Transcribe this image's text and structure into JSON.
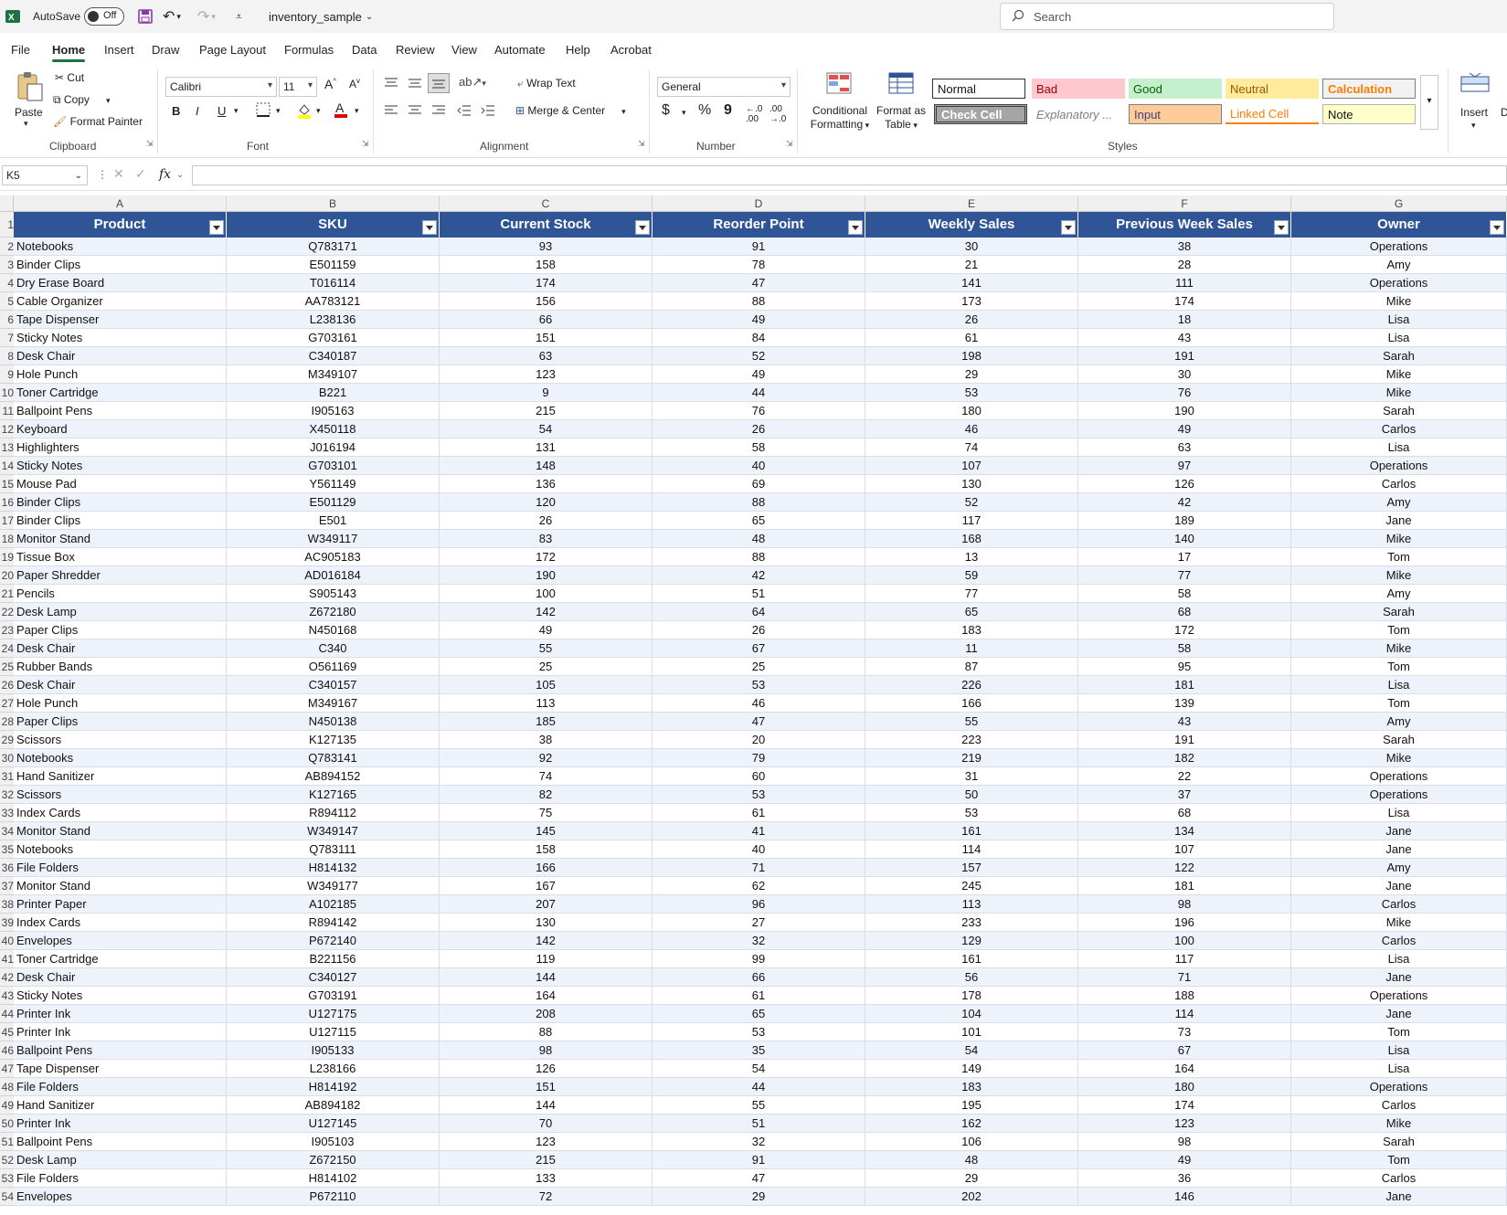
{
  "titlebar": {
    "autosave_label": "AutoSave",
    "autosave_state": "Off",
    "filename": "inventory_sample",
    "search_placeholder": "Search"
  },
  "menu": [
    "File",
    "Home",
    "Insert",
    "Draw",
    "Page Layout",
    "Formulas",
    "Data",
    "Review",
    "View",
    "Automate",
    "Help",
    "Acrobat"
  ],
  "ribbon": {
    "clipboard": {
      "paste": "Paste",
      "cut": "Cut",
      "copy": "Copy",
      "format_painter": "Format Painter",
      "label": "Clipboard"
    },
    "font": {
      "name": "Calibri",
      "size": "11",
      "bold": "B",
      "italic": "I",
      "underline": "U",
      "label": "Font"
    },
    "alignment": {
      "wrap_text": "Wrap Text",
      "merge_center": "Merge & Center",
      "label": "Alignment"
    },
    "number": {
      "format": "General",
      "currency": "$",
      "percent": "%",
      "comma": "9",
      "label": "Number"
    },
    "styles": {
      "conditional": "Conditional",
      "conditional2": "Formatting",
      "format_table": "Format as",
      "format_table2": "Table",
      "label": "Styles",
      "cells": [
        "Normal",
        "Bad",
        "Good",
        "Neutral",
        "Calculation",
        "Check Cell",
        "Explanatory ...",
        "Input",
        "Linked Cell",
        "Note"
      ]
    },
    "cells": {
      "insert": "Insert",
      "d": "D"
    }
  },
  "formula_bar": {
    "name_box": "K5",
    "fx": "fx",
    "value": ""
  },
  "columns": [
    "A",
    "B",
    "C",
    "D",
    "E",
    "F",
    "G"
  ],
  "headers": [
    "Product",
    "SKU",
    "Current Stock",
    "Reorder Point",
    "Weekly Sales",
    "Previous Week Sales",
    "Owner"
  ],
  "row_numbers": [
    "1",
    "2",
    "3",
    "4",
    "5",
    "6",
    "7",
    "8",
    "9",
    "10",
    "11",
    "12",
    "13",
    "14",
    "15",
    "16",
    "17",
    "18",
    "19",
    "20",
    "21",
    "22",
    "23",
    "24",
    "25",
    "26",
    "27",
    "28",
    "29",
    "30",
    "31",
    "32",
    "33",
    "34",
    "35",
    "36",
    "37",
    "38",
    "39",
    "40",
    "41",
    "42",
    "43",
    "44",
    "45",
    "46",
    "47",
    "48",
    "49",
    "50",
    "51",
    "52",
    "53",
    "54"
  ],
  "rows": [
    [
      "Notebooks",
      "Q783171",
      "93",
      "91",
      "30",
      "38",
      "Operations"
    ],
    [
      "Binder Clips",
      "E501159",
      "158",
      "78",
      "21",
      "28",
      "Amy"
    ],
    [
      "Dry Erase Board",
      "T016114",
      "174",
      "47",
      "141",
      "111",
      "Operations"
    ],
    [
      "Cable Organizer",
      "AA783121",
      "156",
      "88",
      "173",
      "174",
      "Mike"
    ],
    [
      "Tape Dispenser",
      "L238136",
      "66",
      "49",
      "26",
      "18",
      "Lisa"
    ],
    [
      "Sticky Notes",
      "G703161",
      "151",
      "84",
      "61",
      "43",
      "Lisa"
    ],
    [
      "Desk Chair",
      "C340187",
      "63",
      "52",
      "198",
      "191",
      "Sarah"
    ],
    [
      "Hole Punch",
      "M349107",
      "123",
      "49",
      "29",
      "30",
      "Mike"
    ],
    [
      "Toner Cartridge",
      "B221",
      "9",
      "44",
      "53",
      "76",
      "Mike"
    ],
    [
      "Ballpoint Pens",
      "I905163",
      "215",
      "76",
      "180",
      "190",
      "Sarah"
    ],
    [
      "Keyboard",
      "X450118",
      "54",
      "26",
      "46",
      "49",
      "Carlos"
    ],
    [
      "Highlighters",
      "J016194",
      "131",
      "58",
      "74",
      "63",
      "Lisa"
    ],
    [
      "Sticky Notes",
      "G703101",
      "148",
      "40",
      "107",
      "97",
      "Operations"
    ],
    [
      "Mouse Pad",
      "Y561149",
      "136",
      "69",
      "130",
      "126",
      "Carlos"
    ],
    [
      "Binder Clips",
      "E501129",
      "120",
      "88",
      "52",
      "42",
      "Amy"
    ],
    [
      "Binder Clips",
      "E501",
      "26",
      "65",
      "117",
      "189",
      "Jane"
    ],
    [
      "Monitor Stand",
      "W349117",
      "83",
      "48",
      "168",
      "140",
      "Mike"
    ],
    [
      "Tissue Box",
      "AC905183",
      "172",
      "88",
      "13",
      "17",
      "Tom"
    ],
    [
      "Paper Shredder",
      "AD016184",
      "190",
      "42",
      "59",
      "77",
      "Mike"
    ],
    [
      "Pencils",
      "S905143",
      "100",
      "51",
      "77",
      "58",
      "Amy"
    ],
    [
      "Desk Lamp",
      "Z672180",
      "142",
      "64",
      "65",
      "68",
      "Sarah"
    ],
    [
      "Paper Clips",
      "N450168",
      "49",
      "26",
      "183",
      "172",
      "Tom"
    ],
    [
      "Desk Chair",
      "C340",
      "55",
      "67",
      "11",
      "58",
      "Mike"
    ],
    [
      "Rubber Bands",
      "O561169",
      "25",
      "25",
      "87",
      "95",
      "Tom"
    ],
    [
      "Desk Chair",
      "C340157",
      "105",
      "53",
      "226",
      "181",
      "Lisa"
    ],
    [
      "Hole Punch",
      "M349167",
      "113",
      "46",
      "166",
      "139",
      "Tom"
    ],
    [
      "Paper Clips",
      "N450138",
      "185",
      "47",
      "55",
      "43",
      "Amy"
    ],
    [
      "Scissors",
      "K127135",
      "38",
      "20",
      "223",
      "191",
      "Sarah"
    ],
    [
      "Notebooks",
      "Q783141",
      "92",
      "79",
      "219",
      "182",
      "Mike"
    ],
    [
      "Hand Sanitizer",
      "AB894152",
      "74",
      "60",
      "31",
      "22",
      "Operations"
    ],
    [
      "Scissors",
      "K127165",
      "82",
      "53",
      "50",
      "37",
      "Operations"
    ],
    [
      "Index Cards",
      "R894112",
      "75",
      "61",
      "53",
      "68",
      "Lisa"
    ],
    [
      "Monitor Stand",
      "W349147",
      "145",
      "41",
      "161",
      "134",
      "Jane"
    ],
    [
      "Notebooks",
      "Q783111",
      "158",
      "40",
      "114",
      "107",
      "Jane"
    ],
    [
      "File Folders",
      "H814132",
      "166",
      "71",
      "157",
      "122",
      "Amy"
    ],
    [
      "Monitor Stand",
      "W349177",
      "167",
      "62",
      "245",
      "181",
      "Jane"
    ],
    [
      "Printer Paper",
      "A102185",
      "207",
      "96",
      "113",
      "98",
      "Carlos"
    ],
    [
      "Index Cards",
      "R894142",
      "130",
      "27",
      "233",
      "196",
      "Mike"
    ],
    [
      "Envelopes",
      "P672140",
      "142",
      "32",
      "129",
      "100",
      "Carlos"
    ],
    [
      "Toner Cartridge",
      "B221156",
      "119",
      "99",
      "161",
      "117",
      "Lisa"
    ],
    [
      "Desk Chair",
      "C340127",
      "144",
      "66",
      "56",
      "71",
      "Jane"
    ],
    [
      "Sticky Notes",
      "G703191",
      "164",
      "61",
      "178",
      "188",
      "Operations"
    ],
    [
      "Printer Ink",
      "U127175",
      "208",
      "65",
      "104",
      "114",
      "Jane"
    ],
    [
      "Printer Ink",
      "U127115",
      "88",
      "53",
      "101",
      "73",
      "Tom"
    ],
    [
      "Ballpoint Pens",
      "I905133",
      "98",
      "35",
      "54",
      "67",
      "Lisa"
    ],
    [
      "Tape Dispenser",
      "L238166",
      "126",
      "54",
      "149",
      "164",
      "Lisa"
    ],
    [
      "File Folders",
      "H814192",
      "151",
      "44",
      "183",
      "180",
      "Operations"
    ],
    [
      "Hand Sanitizer",
      "AB894182",
      "144",
      "55",
      "195",
      "174",
      "Carlos"
    ],
    [
      "Printer Ink",
      "U127145",
      "70",
      "51",
      "162",
      "123",
      "Mike"
    ],
    [
      "Ballpoint Pens",
      "I905103",
      "123",
      "32",
      "106",
      "98",
      "Sarah"
    ],
    [
      "Desk Lamp",
      "Z672150",
      "215",
      "91",
      "48",
      "49",
      "Tom"
    ],
    [
      "File Folders",
      "H814102",
      "133",
      "47",
      "29",
      "36",
      "Carlos"
    ],
    [
      "Envelopes",
      "P672110",
      "72",
      "29",
      "202",
      "146",
      "Jane"
    ]
  ],
  "colors": {
    "header_bg": "#2f5597",
    "row_alt": "#eef2fa",
    "excel_green": "#1e7145"
  }
}
